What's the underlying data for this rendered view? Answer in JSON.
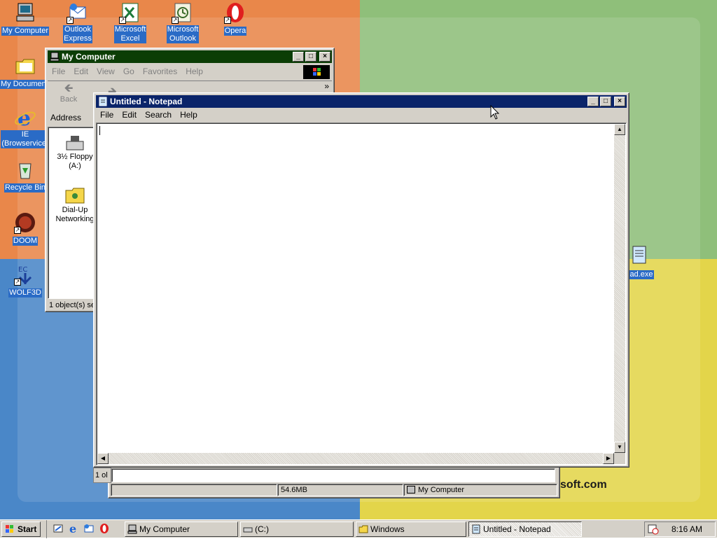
{
  "desktop": {
    "icons": [
      {
        "label": "My Computer"
      },
      {
        "label": "Outlook\nExpress"
      },
      {
        "label": "Microsoft\nExcel"
      },
      {
        "label": "Microsoft\nOutlook"
      },
      {
        "label": "Opera"
      },
      {
        "label": "My Documents"
      },
      {
        "label": "IE\n(Browservice)"
      },
      {
        "label": "Recycle Bin"
      },
      {
        "label": "DOOM"
      },
      {
        "label": "WOLF3D"
      },
      {
        "label": "ad.exe"
      }
    ],
    "wallpaper_text": "soft.com"
  },
  "mycomputer": {
    "title": "My Computer",
    "menu": [
      "File",
      "Edit",
      "View",
      "Go",
      "Favorites",
      "Help"
    ],
    "toolbar": {
      "back": "Back",
      "more": "»"
    },
    "address_label": "Address",
    "items": [
      {
        "label": "3½ Floppy\n(A:)"
      },
      {
        "label": "Dial-Up\nNetworking"
      }
    ],
    "status": "1 object(s) se"
  },
  "notepad": {
    "title": "Untitled - Notepad",
    "menu": [
      "File",
      "Edit",
      "Search",
      "Help"
    ],
    "text": ""
  },
  "windows_explorer": {
    "status_left": "1 ol",
    "size": "54.6MB",
    "location": "My Computer"
  },
  "taskbar": {
    "start": "Start",
    "buttons": [
      "My Computer",
      "(C:)",
      "Windows",
      "Untitled - Notepad"
    ],
    "clock": "8:16 AM"
  },
  "colors": {
    "active_title": "#0a246a",
    "inactive_title": "#0b3d05",
    "icon_label_bg": "#2a6bc6"
  }
}
